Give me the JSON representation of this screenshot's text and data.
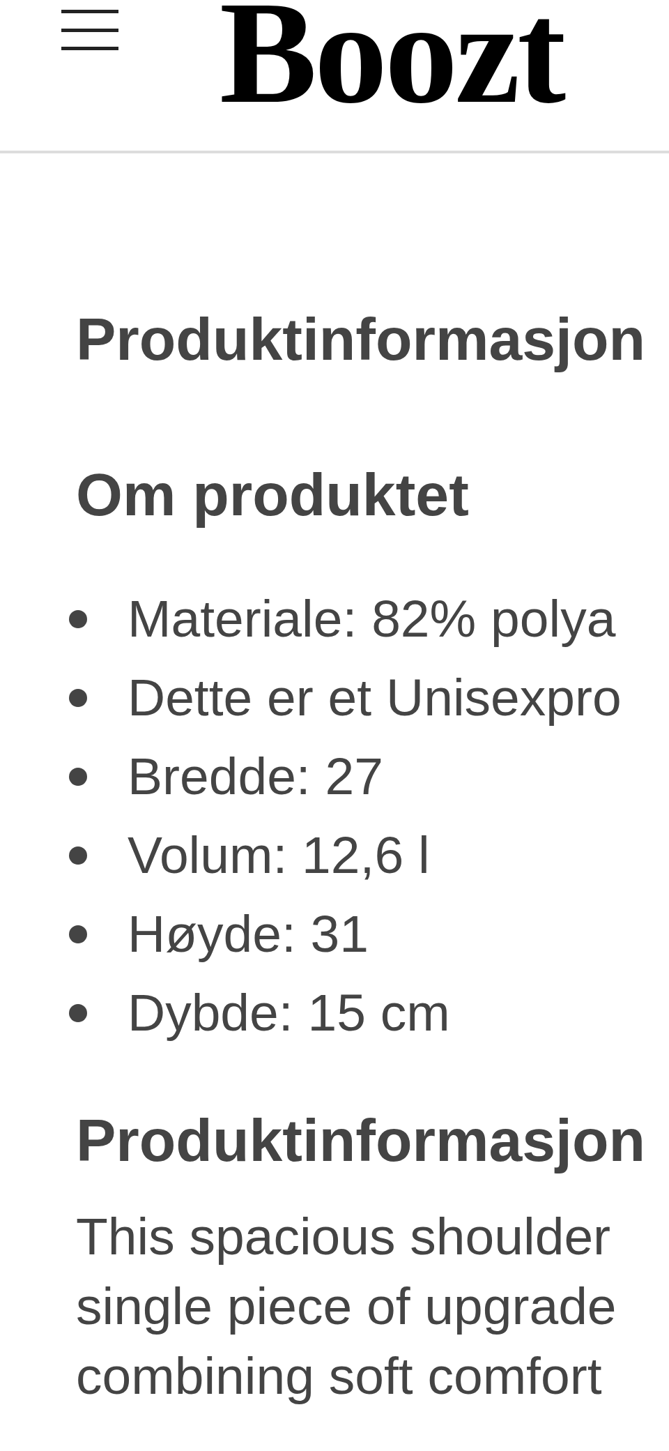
{
  "header": {
    "logo": "Boozt"
  },
  "sections": [
    {
      "kind": "title",
      "heading": "Produktinformasjon"
    },
    {
      "kind": "list",
      "heading": "Om produktet",
      "items": [
        "Materiale: 82% polya",
        "Dette er et Unisexpro",
        "Bredde: 27",
        "Volum: 12,6 l",
        "Høyde: 31",
        "Dybde: 15 cm"
      ]
    },
    {
      "kind": "text",
      "heading": "Produktinformasjon",
      "lines": [
        "This spacious shoulder",
        "single piece of upgrade",
        "combining soft comfort"
      ]
    }
  ]
}
